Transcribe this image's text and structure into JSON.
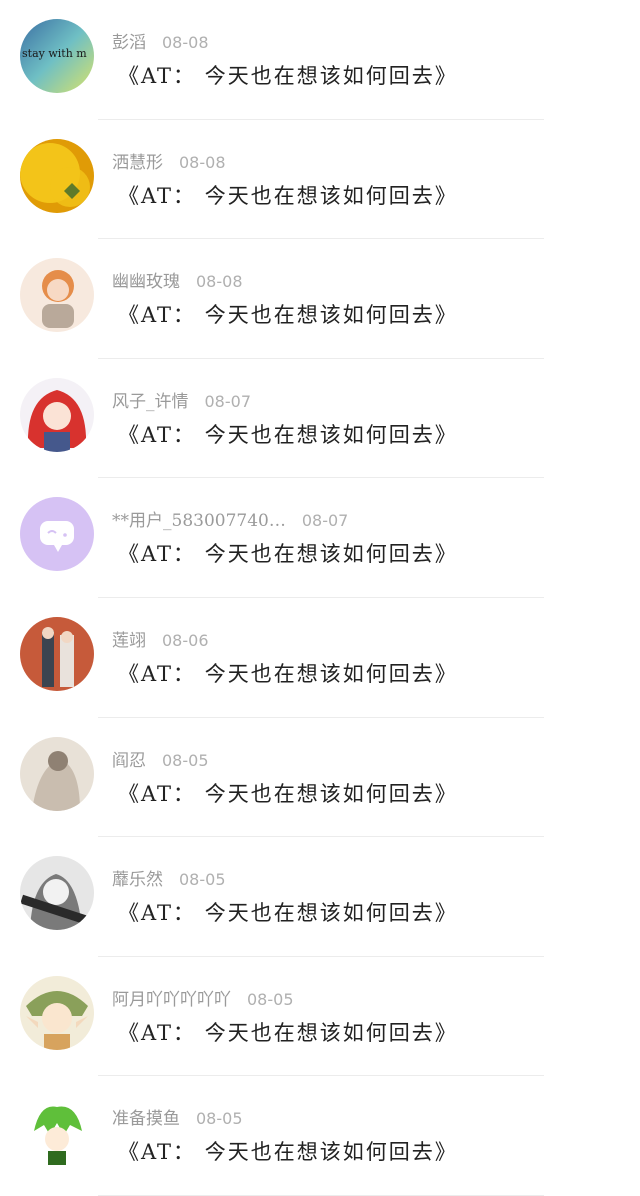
{
  "comments": [
    {
      "user": "彭滔",
      "date": "08-08",
      "text": "《AT： 今天也在想该如何回去》",
      "avatar": "avatar-stay-with-me",
      "avatar_text": "stay with m",
      "colors": [
        "#d9e36a",
        "#6fbfc4",
        "#3b6fa3"
      ]
    },
    {
      "user": "洒慧形",
      "date": "08-08",
      "text": "《AT： 今天也在想该如何回去》",
      "avatar": "avatar-yellow-flower",
      "colors": [
        "#f3c419",
        "#e09b06",
        "#5f7a2a"
      ]
    },
    {
      "user": "幽幽玫瑰",
      "date": "08-08",
      "text": "《AT： 今天也在想该如何回去》",
      "avatar": "avatar-anime-boy",
      "colors": [
        "#f7e9de",
        "#e58d4a",
        "#b9a99a"
      ]
    },
    {
      "user": "风子_许情",
      "date": "08-07",
      "text": "《AT： 今天也在想该如何回去》",
      "avatar": "avatar-red-hair-girl",
      "colors": [
        "#f4f1f6",
        "#d8322e",
        "#45588c"
      ]
    },
    {
      "user": "**用户_583007740…",
      "date": "08-07",
      "text": "《AT： 今天也在想该如何回去》",
      "avatar": "avatar-default-chat",
      "colors": [
        "#d6c2f4",
        "#ffffff"
      ]
    },
    {
      "user": "莲翊",
      "date": "08-06",
      "text": "《AT： 今天也在想该如何回去》",
      "avatar": "avatar-couple-autumn",
      "colors": [
        "#c65a3a",
        "#e9e2dc",
        "#3c4450"
      ]
    },
    {
      "user": "阎忍",
      "date": "08-05",
      "text": "《AT： 今天也在想该如何回去》",
      "avatar": "avatar-muted-figure",
      "colors": [
        "#c9bdaf",
        "#8f8173",
        "#e8e1d7"
      ]
    },
    {
      "user": "蘼乐然",
      "date": "08-05",
      "text": "《AT： 今天也在想该如何回去》",
      "avatar": "avatar-bw-girl",
      "colors": [
        "#e6e6e6",
        "#2a2a2a",
        "#7a7a7a"
      ]
    },
    {
      "user": "阿月吖吖吖吖吖",
      "date": "08-05",
      "text": "《AT： 今天也在想该如何回去》",
      "avatar": "avatar-elf-girl",
      "colors": [
        "#f2ecd9",
        "#8aa05a",
        "#d7a35e"
      ]
    },
    {
      "user": "准备摸鱼",
      "date": "08-05",
      "text": "《AT： 今天也在想该如何回去》",
      "avatar": "avatar-green-chibi",
      "colors": [
        "#ffffff",
        "#5fbf3a",
        "#2f6b1f"
      ]
    }
  ]
}
